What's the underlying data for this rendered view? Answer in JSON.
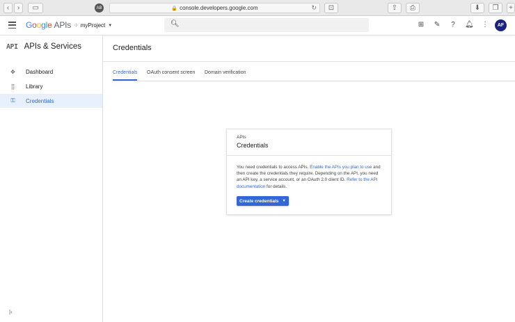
{
  "browser": {
    "url": "console.developers.google.com"
  },
  "header": {
    "logo_google": [
      "G",
      "o",
      "o",
      "g",
      "l",
      "e"
    ],
    "logo_apis": "APIs",
    "project": "myProject",
    "avatar_initials": "AF"
  },
  "sidebar": {
    "api_mark": "API",
    "title": "APIs & Services",
    "items": [
      {
        "label": "Dashboard",
        "icon": "dashboard-icon",
        "active": false
      },
      {
        "label": "Library",
        "icon": "library-icon",
        "active": false
      },
      {
        "label": "Credentials",
        "icon": "key-icon",
        "active": true
      }
    ]
  },
  "main": {
    "title": "Credentials",
    "tabs": [
      {
        "label": "Credentials",
        "active": true
      },
      {
        "label": "OAuth consent screen",
        "active": false
      },
      {
        "label": "Domain verification",
        "active": false
      }
    ],
    "card": {
      "kicker": "APIs",
      "title": "Credentials",
      "body_1": "You need credentials to access APIs. ",
      "link_1": "Enable the APIs you plan to use",
      "body_2": " and then create the credentials they require. Depending on the API, you need an API key, a service account, or an OAuth 2.0 client ID. ",
      "link_2": "Refer to the API documentation",
      "body_3": " for details.",
      "button_label": "Create credentials"
    }
  },
  "colors": {
    "accent": "#3367d6",
    "active_bg": "#e8f0fe"
  }
}
